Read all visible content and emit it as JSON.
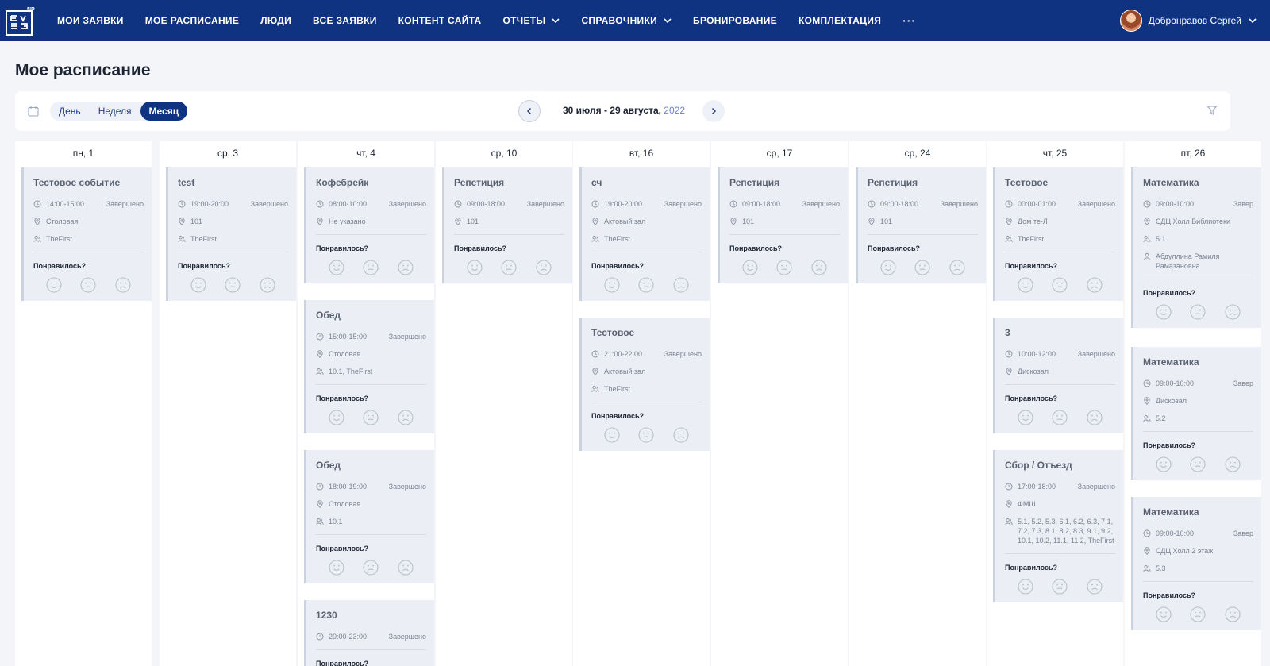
{
  "nav": {
    "items": [
      "МОИ ЗАЯВКИ",
      "МОЕ РАСПИСАНИЕ",
      "ЛЮДИ",
      "ВСЕ ЗАЯВКИ",
      "КОНТЕНТ САЙТА",
      "ОТЧЕТЫ",
      "СПРАВОЧНИКИ",
      "БРОНИРОВАНИЕ",
      "КОМПЛЕКТАЦИЯ"
    ],
    "more": "···",
    "user": "Добронравов Сергей",
    "logo_text": "ЕМЭ NP"
  },
  "page": {
    "title": "Мое расписание"
  },
  "toolbar": {
    "views": [
      "День",
      "Неделя",
      "Месяц"
    ],
    "active_view": "Месяц",
    "range_text": "30 июля - 29 августа, ",
    "range_year": "2022"
  },
  "liked_label": "Понравилось?",
  "colors": {
    "nav_bg": "#0f3381",
    "card_bg": "#ebeef4",
    "accent": "#0f3381"
  },
  "columns": [
    {
      "day": "пн,  1",
      "cards": [
        {
          "title": "Тестовое событие",
          "time": "14:00-15:00",
          "status": "Завершено",
          "place": "Столовая",
          "group": "TheFirst"
        }
      ]
    },
    {
      "day": "ср,  3",
      "cards": [
        {
          "title": "test",
          "time": "19:00-20:00",
          "status": "Завершено",
          "place": "101",
          "group": "TheFirst"
        }
      ]
    },
    {
      "day": "чт,  4",
      "cards": [
        {
          "title": "Кофебрейк",
          "time": "08:00-10:00",
          "status": "Завершено",
          "place": "Не указано"
        },
        {
          "title": "Обед",
          "time": "15:00-15:00",
          "status": "Завершено",
          "place": "Столовая",
          "group": "10.1, TheFirst"
        },
        {
          "title": "Обед",
          "time": "18:00-19:00",
          "status": "Завершено",
          "place": "Столовая",
          "group": "10.1"
        },
        {
          "title": "1230",
          "time": "20:00-23:00",
          "status": "Завершено"
        }
      ]
    },
    {
      "day": "ср,  10",
      "cards": [
        {
          "title": "Репетиция",
          "time": "09:00-18:00",
          "status": "Завершено",
          "place": "101"
        }
      ]
    },
    {
      "day": "вт,  16",
      "cards": [
        {
          "title": "сч",
          "time": "19:00-20:00",
          "status": "Завершено",
          "place": "Актовый зал",
          "group": "TheFirst"
        },
        {
          "title": "Тестовое",
          "time": "21:00-22:00",
          "status": "Завершено",
          "place": "Актовый зал",
          "group": "TheFirst"
        }
      ]
    },
    {
      "day": "ср,  17",
      "cards": [
        {
          "title": "Репетиция",
          "time": "09:00-18:00",
          "status": "Завершено",
          "place": "101"
        }
      ]
    },
    {
      "day": "ср,  24",
      "cards": [
        {
          "title": "Репетиция",
          "time": "09:00-18:00",
          "status": "Завершено",
          "place": "101"
        }
      ]
    },
    {
      "day": "чт,  25",
      "cards": [
        {
          "title": "Тестовое",
          "time": "00:00-01:00",
          "status": "Завершено",
          "place": "Дом те-Л",
          "group": "TheFirst"
        },
        {
          "title": "3",
          "time": "10:00-12:00",
          "status": "Завершено",
          "place": "Дискозал"
        },
        {
          "title": "Сбор / Отъезд",
          "time": "17:00-18:00",
          "status": "Завершено",
          "place": "ФМШ",
          "group": "5.1, 5.2, 5.3, 6.1, 6.2, 6.3, 7.1, 7.2, 7.3, 8.1, 8.2, 8.3, 9.1, 9.2, 10.1, 10.2, 11.1, 11.2, TheFirst"
        }
      ]
    },
    {
      "day": "пт,  26",
      "cards": [
        {
          "title": "Математика",
          "time": "09:00-10:00",
          "status": "Завер",
          "place": "СДЦ Холл Библиотеки",
          "group": "5.1",
          "person": "Абдуллина Рамиля Рамазановна"
        },
        {
          "title": "Математика",
          "time": "09:00-10:00",
          "status": "Завер",
          "place": "Дискозал",
          "group": "5.2"
        },
        {
          "title": "Математика",
          "time": "09:00-10:00",
          "status": "Завер",
          "place": "СДЦ Холл 2 этаж",
          "group": "5.3"
        }
      ]
    }
  ]
}
